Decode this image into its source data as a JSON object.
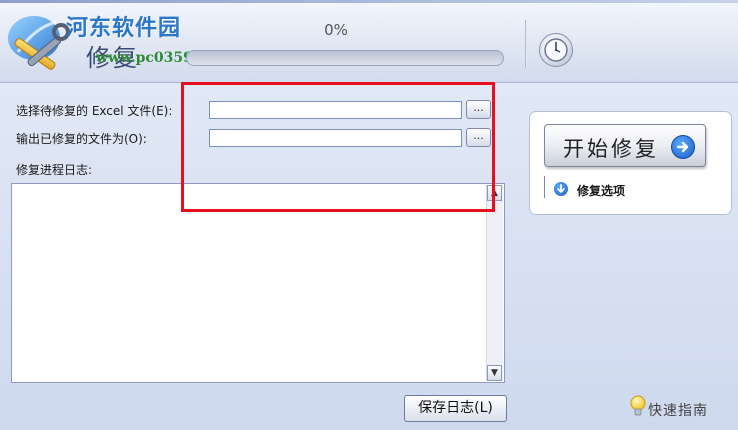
{
  "header": {
    "app_title": "修复",
    "watermark_name": "河东软件园",
    "watermark_url": "www.pc0359.cn",
    "progress_text": "0%",
    "progress_value": 0,
    "clock_icon": "clock-icon",
    "logo_icon": "tools-wrench-screwdriver-icon"
  },
  "form": {
    "source_label": "选择待修复的 Excel 文件(E):",
    "source_value": "",
    "output_label": "输出已修复的文件为(O):",
    "output_value": "",
    "browse_label": "...",
    "log_label": "修复进程日志:",
    "log_text": "",
    "save_log_label": "保存日志(L)"
  },
  "panel": {
    "start_label": "开始修复",
    "options_label": "修复选项"
  },
  "footer": {
    "guide_label": "快速指南",
    "guide_icon": "lightbulb-icon"
  },
  "colors": {
    "highlight": "#e8101c",
    "accent_blue": "#1a5fc4",
    "watermark_blue": "#2a77c6",
    "watermark_green": "#2f8a35"
  }
}
